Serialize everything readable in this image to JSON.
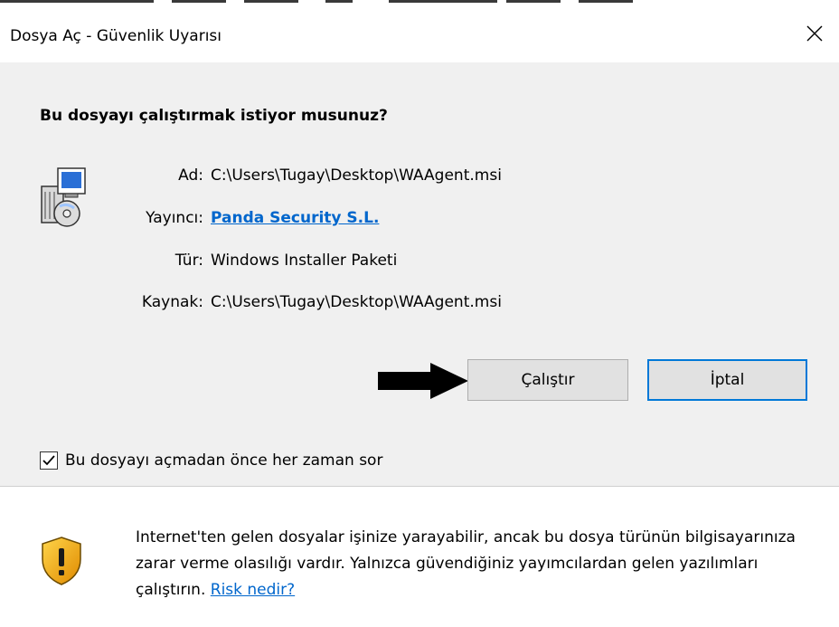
{
  "window": {
    "title": "Dosya Aç - Güvenlik Uyarısı"
  },
  "question": "Bu dosyayı çalıştırmak istiyor musunuz?",
  "details": [
    {
      "label": "Ad:",
      "value": "C:\\Users\\Tugay\\Desktop\\WAAgent.msi"
    },
    {
      "label": "Yayıncı:",
      "value": "Panda Security S.L."
    },
    {
      "label": "Tür:",
      "value": "Windows Installer Paketi"
    },
    {
      "label": "Kaynak:",
      "value": "C:\\Users\\Tugay\\Desktop\\WAAgent.msi"
    }
  ],
  "buttons": {
    "run": "Çalıştır",
    "cancel": "İptal"
  },
  "checkbox": {
    "label": "Bu dosyayı açmadan önce her zaman sor",
    "checked": true
  },
  "warning": {
    "text": "Internet'ten gelen dosyalar işinize yarayabilir, ancak bu dosya türünün bilgisayarınıza zarar verme olasılığı vardır. Yalnızca güvendiğiniz yayımcılardan gelen yazılımları çalıştırın.",
    "link": "Risk nedir?"
  },
  "icons": {
    "app": "installer-package-icon",
    "shield": "warning-shield-icon",
    "close": "close-icon",
    "arrow": "pointer-arrow-icon",
    "check": "checkmark-icon"
  },
  "colors": {
    "link": "#0066cc",
    "default_button_border": "#0078d7",
    "dialog_background": "#f0f0f0"
  }
}
